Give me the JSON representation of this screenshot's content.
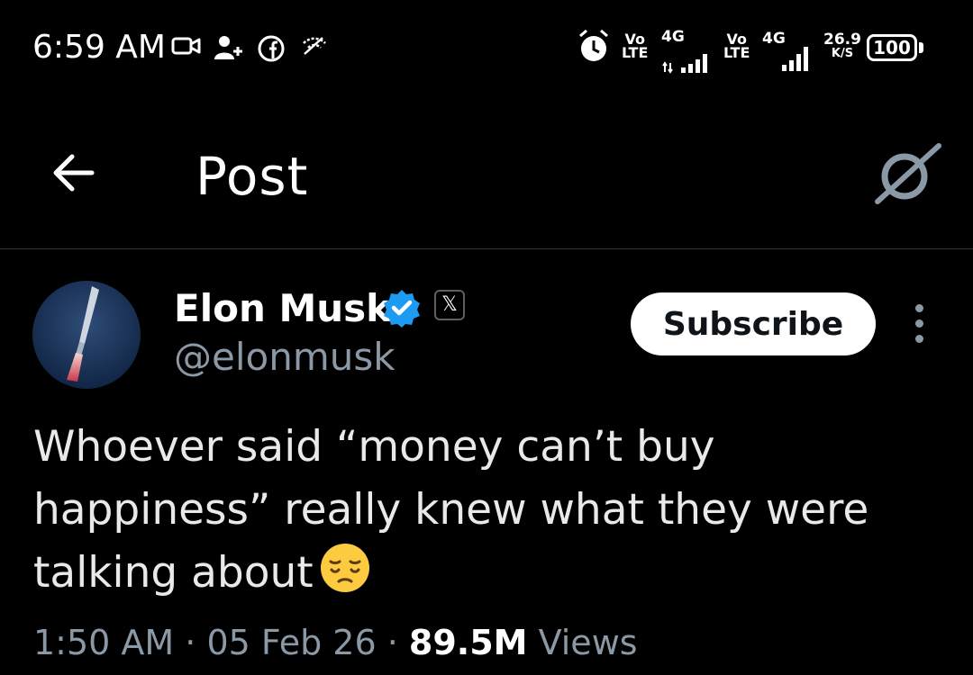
{
  "status_bar": {
    "time": "6:59 AM",
    "left_icons": [
      "video-call-icon",
      "add-contact-icon",
      "facebook-icon",
      "wifi-slash-icon"
    ],
    "sim1": {
      "vo": "Vo",
      "lte": "LTE",
      "net": "4G"
    },
    "sim2": {
      "vo": "Vo",
      "lte": "LTE",
      "net": "4G"
    },
    "speed_value": "26.9",
    "speed_unit": "K/S",
    "battery": "100"
  },
  "header": {
    "title": "Post",
    "back_icon": "arrow-left-icon",
    "grok_icon": "grok-icon"
  },
  "post": {
    "author_name": "Elon Musk",
    "handle": "@elonmusk",
    "affiliation_badge": "𝕏",
    "subscribe_label": "Subscribe",
    "text_line1": "Whoever said “money can’t buy",
    "text_line2": "happiness” really knew what they were",
    "text_line3": "talking about",
    "emoji": "pensive-face",
    "time": "1:50 AM",
    "dot1": "·",
    "date": "05 Feb 26",
    "dot2": "·",
    "views_count": "89.5M",
    "views_label": "Views"
  },
  "colors": {
    "background": "#000000",
    "text": "#e7e9ea",
    "secondary": "#8b98a5",
    "verified": "#1d9bf0",
    "divider": "#2f3336"
  }
}
